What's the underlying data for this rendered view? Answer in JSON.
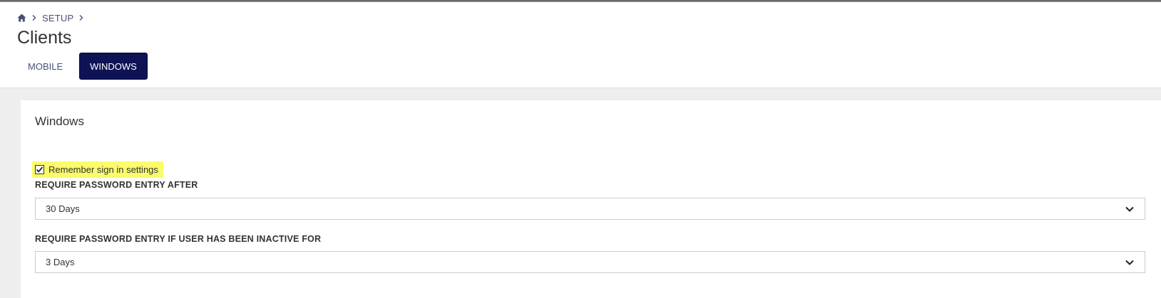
{
  "breadcrumb": {
    "home_icon": "home-icon",
    "items": [
      {
        "label": "SETUP"
      }
    ]
  },
  "page": {
    "title": "Clients"
  },
  "tabs": [
    {
      "label": "MOBILE",
      "active": false
    },
    {
      "label": "WINDOWS",
      "active": true
    }
  ],
  "card": {
    "title": "Windows",
    "remember_sign_in": {
      "label": "Remember sign in settings",
      "checked": true,
      "highlight_color": "#fbfb6b"
    },
    "password_after": {
      "label": "REQUIRE PASSWORD ENTRY AFTER",
      "value": "30 Days"
    },
    "password_inactive": {
      "label": "REQUIRE PASSWORD ENTRY IF USER HAS BEEN INACTIVE FOR",
      "value": "3 Days"
    }
  },
  "colors": {
    "accent": "#0f1356",
    "link": "#4a4f7a"
  }
}
